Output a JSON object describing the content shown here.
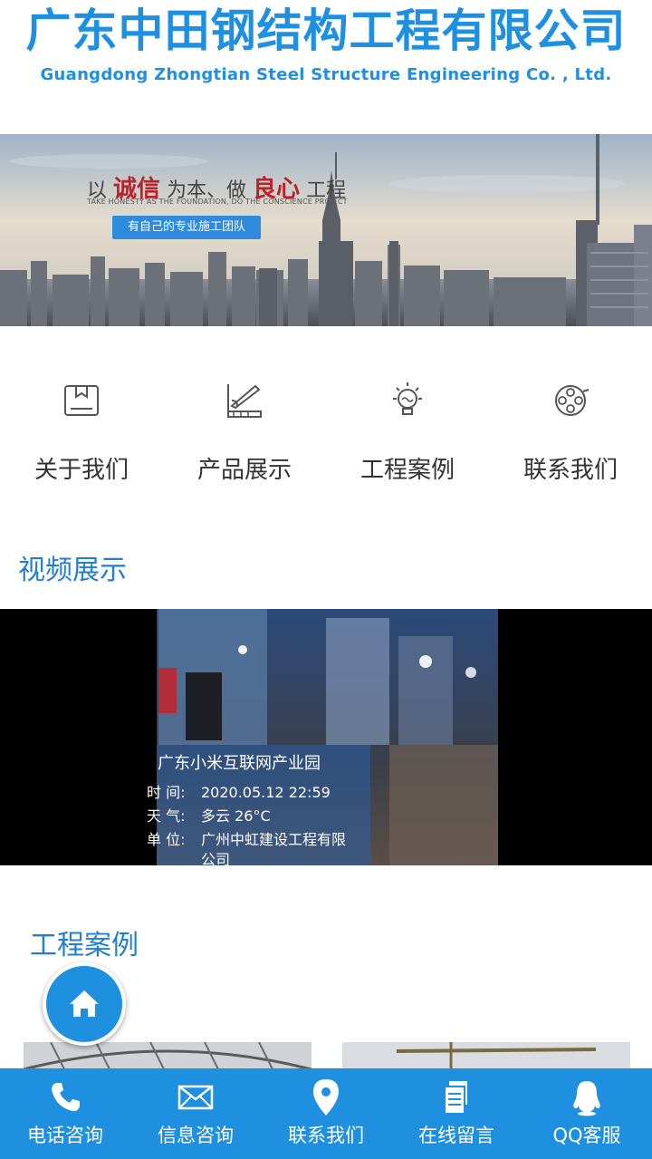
{
  "header": {
    "company_cn": "广东中田钢结构工程有限公司",
    "company_en": "Guangdong Zhongtian Steel Structure Engineering Co. , Ltd."
  },
  "banner": {
    "slogan_parts": [
      "以",
      "诚信",
      "为本、做",
      "良心",
      "工程"
    ],
    "slogan_en": "TAKE HONESTY AS THE FOUNDATION, DO THE CONSCIENCE PROJECT",
    "button": "有自己的专业施工团队"
  },
  "nav": [
    {
      "label": "关于我们",
      "icon": "about-icon"
    },
    {
      "label": "产品展示",
      "icon": "product-icon"
    },
    {
      "label": "工程案例",
      "icon": "lightbulb-icon"
    },
    {
      "label": "联系我们",
      "icon": "film-reel-icon"
    }
  ],
  "video_section": {
    "title": "视频展示",
    "overlay": {
      "title": "广东小米互联网产业园",
      "rows": [
        {
          "key": "时 间:",
          "value": "2020.05.12 22:59"
        },
        {
          "key": "天 气:",
          "value": "多云 26°C"
        },
        {
          "key": "单 位:",
          "value": "广州中虹建设工程有限"
        },
        {
          "key": "",
          "value": "公司"
        }
      ]
    }
  },
  "cases_section": {
    "title": "工程案例"
  },
  "bottom_bar": [
    {
      "label": "电话咨询",
      "icon": "phone-icon"
    },
    {
      "label": "信息咨询",
      "icon": "mail-icon"
    },
    {
      "label": "联系我们",
      "icon": "location-pin-icon"
    },
    {
      "label": "在线留言",
      "icon": "document-icon"
    },
    {
      "label": "QQ客服",
      "icon": "qq-penguin-icon"
    }
  ],
  "colors": {
    "brand": "#1f8fe0",
    "accent_red": "#b8232a"
  }
}
